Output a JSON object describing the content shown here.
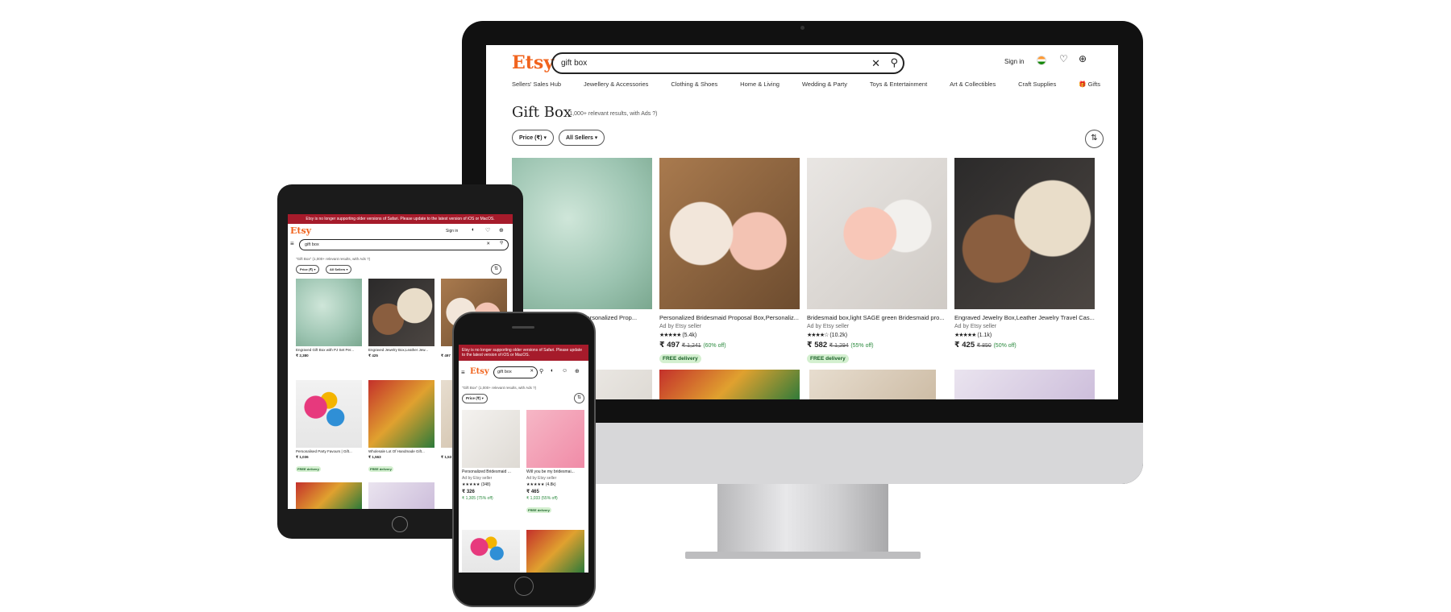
{
  "desktop": {
    "logo": "Etsy",
    "search_value": "gift box",
    "sign_in": "Sign in",
    "nav": [
      "Sellers' Sales Hub",
      "Jewellery & Accessories",
      "Clothing & Shoes",
      "Home & Living",
      "Wedding & Party",
      "Toys & Entertainment",
      "Art & Collectibles",
      "Craft Supplies",
      "Gifts"
    ],
    "title": "Gift Box",
    "count": "(1,000+ relevant results, with Ads ?)",
    "filter_price": "Price (₹) ▾",
    "filter_sellers": "All Sellers ▾",
    "products": [
      {
        "title": "Personalized Gift Box Set Personalized Prop...",
        "seller": "",
        "rating": "",
        "price": "",
        "old": "",
        "off": "",
        "badge": ""
      },
      {
        "title": "Personalized Bridesmaid Proposal Box,Personaliz...",
        "seller": "Ad by Etsy seller",
        "rating": "(5.4k)",
        "price": "₹ 497",
        "old": "₹ 1,241",
        "off": "(60% off)",
        "badge": "FREE delivery"
      },
      {
        "title": "Bridesmaid box,light SAGE green Bridesmaid pro...",
        "seller": "Ad by Etsy seller",
        "rating": "(10.2k)",
        "price": "₹ 582",
        "old": "₹ 1,294",
        "off": "(55% off)",
        "badge": "FREE delivery"
      },
      {
        "title": "Engraved Jewelry Box,Leather Jewelry Travel Cas...",
        "seller": "Ad by Etsy seller",
        "rating": "(1.1k)",
        "price": "₹ 425",
        "old": "₹ 850",
        "off": "(50% off)",
        "badge": ""
      }
    ]
  },
  "tablet": {
    "banner": "Etsy is no longer supporting older versions of Safari. Please update to the latest version of iOS or MacOS.",
    "logo": "Etsy",
    "sign_in": "Sign in",
    "search_value": "gift box",
    "count": "\"Gift Box\" (1,000+ relevant results, with Ads ?)",
    "filter_price": "Price (₹) ▾",
    "filter_sellers": "All Sellers ▾",
    "items": [
      {
        "title": "Engraved Gift Box with PJ Set Per...",
        "price": "₹ 2,380"
      },
      {
        "title": "Engraved Jewelry Box,Leather Jew...",
        "price": "₹ 425"
      },
      {
        "title": "",
        "price": "₹ 497"
      },
      {
        "title": "Personalised Party Favours | Gift...",
        "price": "₹ 1,036"
      },
      {
        "title": "Wholesale Lot Of Handmade Gift...",
        "price": "₹ 1,563"
      },
      {
        "title": "",
        "price": "₹ 1,53"
      }
    ],
    "badge_free": "FREE delivery"
  },
  "phone": {
    "banner": "Etsy is no longer supporting older versions of Safari. Please update to the latest version of iOS or MacOS.",
    "logo": "Etsy",
    "search_value": "gift box",
    "count": "\"Gift Box\" (1,000+ relevant results, with Ads ?)",
    "filter_price": "Price (₹) ▾",
    "items": [
      {
        "title": "Personalized Bridesmaid ...",
        "seller": "Ad by Etsy seller",
        "rating": "(348)",
        "price": "₹ 326",
        "old": "₹ 1,305 (75% off)",
        "badge": ""
      },
      {
        "title": "Will you be my bridesmai...",
        "seller": "Ad by Etsy seller",
        "rating": "(4.8k)",
        "price": "₹ 465",
        "old": "₹ 1,033 (55% off)",
        "badge": "FREE delivery"
      }
    ]
  },
  "colors": {
    "brand": "#f1641e",
    "banner": "#a61b2b",
    "free_badge": "#d4f0d0"
  }
}
